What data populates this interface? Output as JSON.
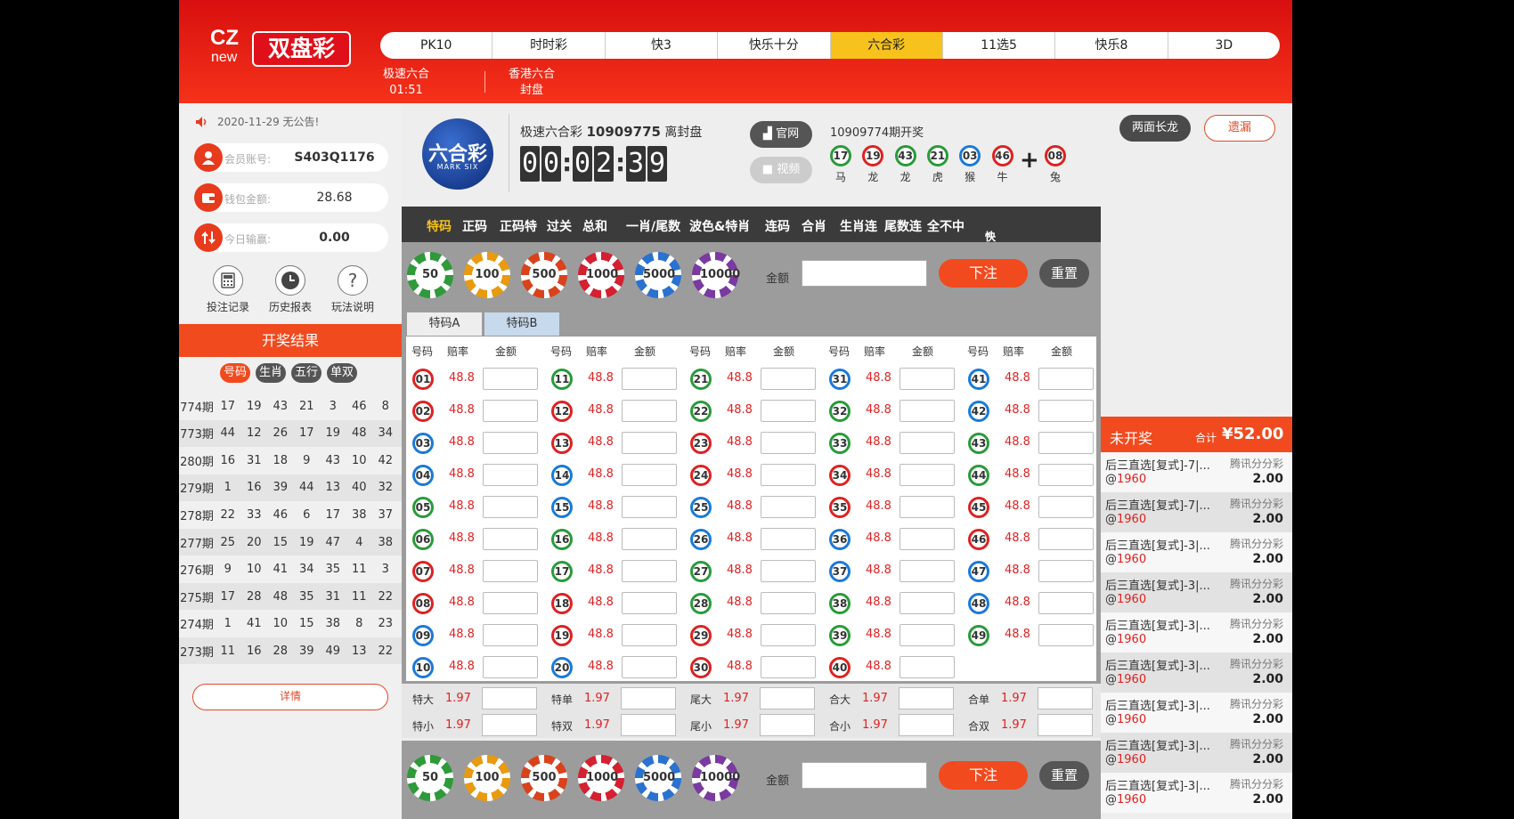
{
  "header": {
    "logo": {
      "brand": "CZ",
      "sub": "new",
      "name": "双盘彩"
    },
    "nav": [
      "PK10",
      "时时彩",
      "快3",
      "快乐十分",
      "六合彩",
      "11选5",
      "快乐8",
      "3D"
    ],
    "nav_active": "六合彩",
    "subnav": [
      {
        "label": "极速六合",
        "status": "01:51"
      },
      {
        "label": "香港六合",
        "status": "封盘"
      }
    ]
  },
  "sidebar": {
    "notice": "2020-11-29 无公告!",
    "account": {
      "label": "会员账号:",
      "value": "S403Q1176"
    },
    "wallet": {
      "label": "钱包金额:",
      "value": "28.68"
    },
    "today": {
      "label": "今日输赢:",
      "value": "0.00"
    },
    "tools": [
      "投注记录",
      "历史报表",
      "玩法说明"
    ],
    "results_title": "开奖结果",
    "result_tabs": [
      "号码",
      "生肖",
      "五行",
      "单双"
    ],
    "results": [
      {
        "period": "774期",
        "nums": [
          "17",
          "19",
          "43",
          "21",
          "3",
          "46",
          "8"
        ]
      },
      {
        "period": "773期",
        "nums": [
          "44",
          "12",
          "26",
          "17",
          "19",
          "48",
          "34"
        ]
      },
      {
        "period": "280期",
        "nums": [
          "16",
          "31",
          "18",
          "9",
          "43",
          "10",
          "42"
        ]
      },
      {
        "period": "279期",
        "nums": [
          "1",
          "16",
          "39",
          "44",
          "13",
          "40",
          "32"
        ]
      },
      {
        "period": "278期",
        "nums": [
          "22",
          "33",
          "46",
          "6",
          "17",
          "38",
          "37"
        ]
      },
      {
        "period": "277期",
        "nums": [
          "25",
          "20",
          "15",
          "19",
          "47",
          "4",
          "38"
        ]
      },
      {
        "period": "276期",
        "nums": [
          "9",
          "10",
          "41",
          "34",
          "35",
          "11",
          "3"
        ]
      },
      {
        "period": "275期",
        "nums": [
          "17",
          "28",
          "48",
          "35",
          "31",
          "11",
          "22"
        ]
      },
      {
        "period": "274期",
        "nums": [
          "1",
          "41",
          "10",
          "15",
          "38",
          "8",
          "23"
        ]
      },
      {
        "period": "273期",
        "nums": [
          "11",
          "16",
          "28",
          "39",
          "49",
          "13",
          "22"
        ]
      }
    ],
    "detail": "详情"
  },
  "game": {
    "logo_text": "六合彩",
    "logo_sub": "MARK SIX",
    "title": "极速六合彩",
    "period": "10909775",
    "closing": "离封盘",
    "countdown": [
      "0",
      "0",
      "0",
      "2",
      "3",
      "9"
    ],
    "btn_official": "官网",
    "btn_video": "视频",
    "next": "10909774期开奖",
    "last_balls": [
      {
        "n": "17",
        "z": "马",
        "c": "green"
      },
      {
        "n": "19",
        "z": "龙",
        "c": "red"
      },
      {
        "n": "43",
        "z": "龙",
        "c": "green"
      },
      {
        "n": "21",
        "z": "虎",
        "c": "green"
      },
      {
        "n": "03",
        "z": "猴",
        "c": "blue"
      },
      {
        "n": "46",
        "z": "牛",
        "c": "red"
      }
    ],
    "special_ball": {
      "n": "08",
      "z": "兔",
      "c": "red"
    }
  },
  "tabs": [
    "特码",
    "正码",
    "正码特",
    "过关",
    "总和",
    "一肖/尾数",
    "波色&特肖",
    "连码",
    "合肖",
    "生肖连",
    "尾数连",
    "全不中"
  ],
  "tab_active": "特码",
  "quick": "快选金额",
  "chips": [
    "50",
    "100",
    "500",
    "1000",
    "5000",
    "10000"
  ],
  "amount_label": "金额",
  "bet_btn": "下注",
  "reset_btn": "重置",
  "sub_tabs": [
    "特码A",
    "特码B"
  ],
  "col_headers": {
    "num": "号码",
    "odds": "赔率",
    "amount": "金额"
  },
  "odds": "48.8",
  "numbers": [
    "01",
    "02",
    "03",
    "04",
    "05",
    "06",
    "07",
    "08",
    "09",
    "10",
    "11",
    "12",
    "13",
    "14",
    "15",
    "16",
    "17",
    "18",
    "19",
    "20",
    "21",
    "22",
    "23",
    "24",
    "25",
    "26",
    "27",
    "28",
    "29",
    "30",
    "31",
    "32",
    "33",
    "34",
    "35",
    "36",
    "37",
    "38",
    "39",
    "40",
    "41",
    "42",
    "43",
    "44",
    "45",
    "46",
    "47",
    "48",
    "49"
  ],
  "two_side": [
    {
      "label": "特大",
      "odds": "1.97"
    },
    {
      "label": "特单",
      "odds": "1.97"
    },
    {
      "label": "尾大",
      "odds": "1.97"
    },
    {
      "label": "合大",
      "odds": "1.97"
    },
    {
      "label": "合单",
      "odds": "1.97"
    },
    {
      "label": "特小",
      "odds": "1.97"
    },
    {
      "label": "特双",
      "odds": "1.97"
    },
    {
      "label": "尾小",
      "odds": "1.97"
    },
    {
      "label": "合小",
      "odds": "1.97"
    },
    {
      "label": "合双",
      "odds": "1.97"
    }
  ],
  "right": {
    "tab1": "两面长龙",
    "tab2": "遗漏",
    "unopened": "未开奖",
    "total_label": "合计",
    "total": "¥52.00",
    "bets": [
      {
        "title": "后三直选[复式]-7|...",
        "game": "腾讯分分彩",
        "at": "@",
        "odds": "1960",
        "amount": "2.00"
      },
      {
        "title": "后三直选[复式]-7|...",
        "game": "腾讯分分彩",
        "at": "@",
        "odds": "1960",
        "amount": "2.00"
      },
      {
        "title": "后三直选[复式]-3|...",
        "game": "腾讯分分彩",
        "at": "@",
        "odds": "1960",
        "amount": "2.00"
      },
      {
        "title": "后三直选[复式]-3|...",
        "game": "腾讯分分彩",
        "at": "@",
        "odds": "1960",
        "amount": "2.00"
      },
      {
        "title": "后三直选[复式]-3|...",
        "game": "腾讯分分彩",
        "at": "@",
        "odds": "1960",
        "amount": "2.00"
      },
      {
        "title": "后三直选[复式]-3|...",
        "game": "腾讯分分彩",
        "at": "@",
        "odds": "1960",
        "amount": "2.00"
      },
      {
        "title": "后三直选[复式]-3|...",
        "game": "腾讯分分彩",
        "at": "@",
        "odds": "1960",
        "amount": "2.00"
      },
      {
        "title": "后三直选[复式]-3|...",
        "game": "腾讯分分彩",
        "at": "@",
        "odds": "1960",
        "amount": "2.00"
      },
      {
        "title": "后三直选[复式]-3|...",
        "game": "腾讯分分彩",
        "at": "@",
        "odds": "1960",
        "amount": "2.00"
      }
    ]
  }
}
